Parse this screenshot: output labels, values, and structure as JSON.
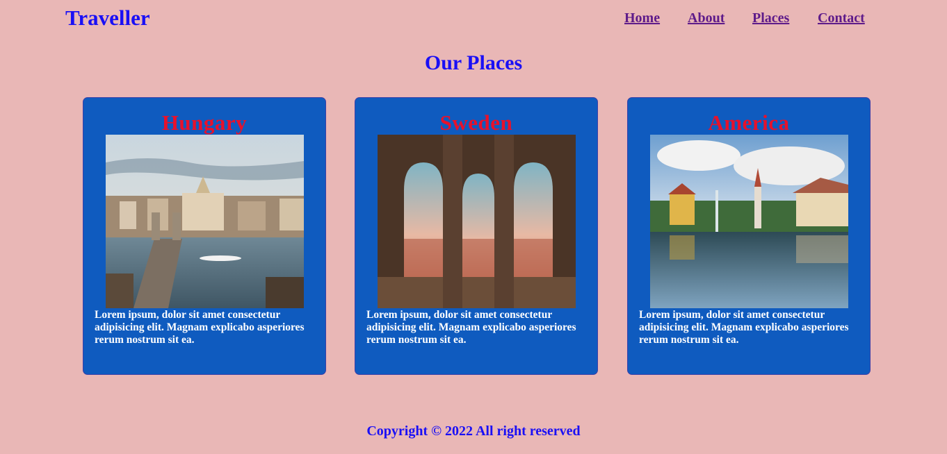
{
  "header": {
    "brand": "Traveller",
    "nav": [
      {
        "label": "Home"
      },
      {
        "label": "About"
      },
      {
        "label": "Places"
      },
      {
        "label": "Contact"
      }
    ]
  },
  "main": {
    "title": "Our Places",
    "cards": [
      {
        "title": "Hungary",
        "text": "Lorem ipsum, dolor sit amet consectetur adipisicing elit. Magnam explicabo asperiores rerum nostrum sit ea.",
        "image": "hungary-photo"
      },
      {
        "title": "Sweden",
        "text": "Lorem ipsum, dolor sit amet consectetur adipisicing elit. Magnam explicabo asperiores rerum nostrum sit ea.",
        "image": "sweden-photo"
      },
      {
        "title": "America",
        "text": "Lorem ipsum, dolor sit amet consectetur adipisicing elit. Magnam explicabo asperiores rerum nostrum sit ea.",
        "image": "america-photo"
      }
    ]
  },
  "footer": {
    "text": "Copyright © 2022 All right reserved"
  },
  "colors": {
    "background": "#e9b7b6",
    "brand": "#1a0ff5",
    "nav_link": "#5e1b8a",
    "card_bg": "#0f5bbf",
    "card_title": "#e8112b",
    "card_text": "#ffffff"
  }
}
